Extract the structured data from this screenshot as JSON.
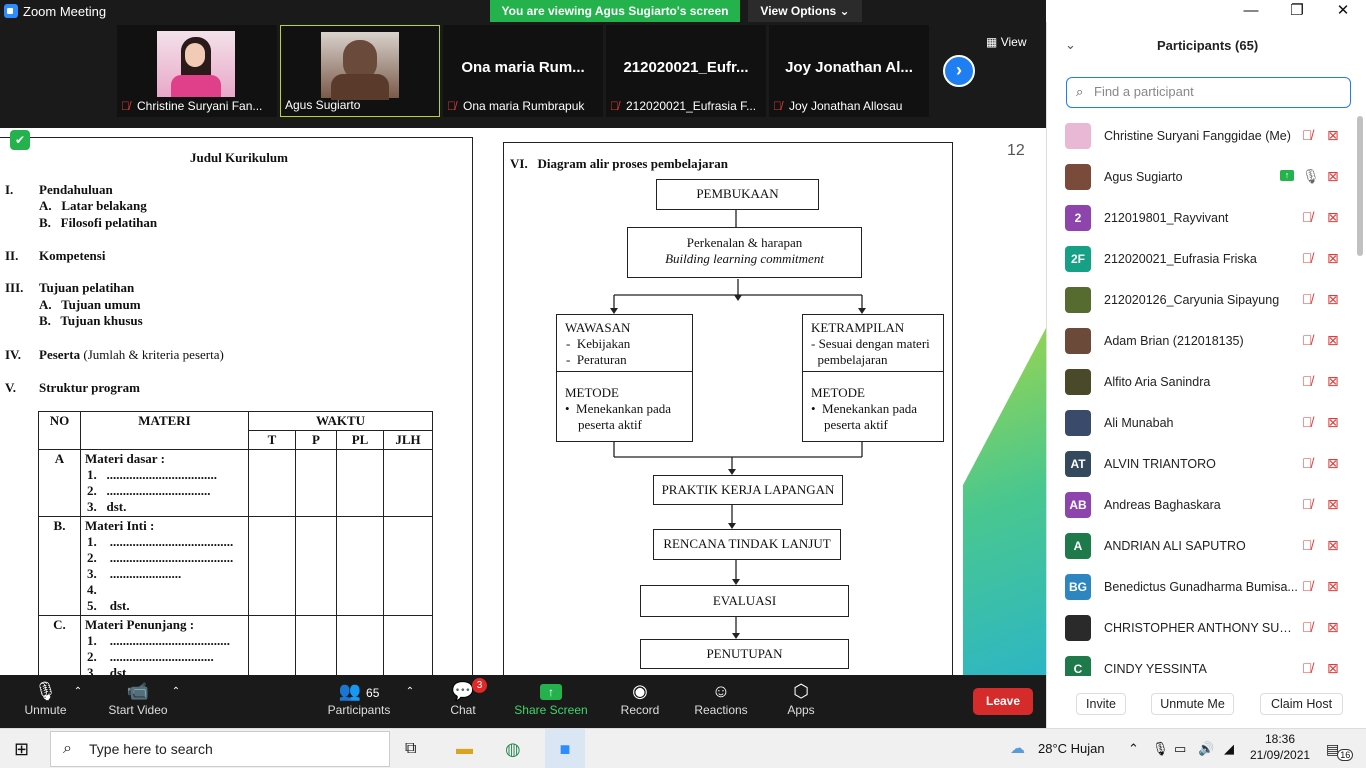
{
  "window": {
    "title": "Zoom Meeting",
    "share_banner": "You are viewing Agus Sugiarto's screen",
    "view_options": "View Options ⌄"
  },
  "strip": {
    "view_label": "View",
    "tiles": [
      {
        "bigname": "",
        "label": "Christine Suryani Fan..."
      },
      {
        "bigname": "",
        "label": "Agus Sugiarto"
      },
      {
        "bigname": "Ona maria Rum...",
        "label": "Ona maria Rumbrapuk"
      },
      {
        "bigname": "212020021_Eufr...",
        "label": "212020021_Eufrasia F..."
      },
      {
        "bigname": "Joy Jonathan Al...",
        "label": "Joy Jonathan Allosau"
      }
    ]
  },
  "doc": {
    "left": {
      "title": "Judul Kurikulum",
      "s1": "I.",
      "s1t": "Pendahuluan",
      "s1a": "A.   Latar belakang",
      "s1b": "B.   Filosofi pelatihan",
      "s2": "II.",
      "s2t": "Kompetensi",
      "s3": "III.",
      "s3t": "Tujuan pelatihan",
      "s3a": "A.   Tujuan umum",
      "s3b": "B.   Tujuan khusus",
      "s4": "IV.",
      "s4t": "Peserta",
      "s4n": "(Jumlah & kriteria peserta)",
      "s5": "V.",
      "s5t": "Struktur program",
      "table": {
        "headers": {
          "no": "NO",
          "materi": "MATERI",
          "waktu": "WAKTU",
          "t": "T",
          "p": "P",
          "pl": "PL",
          "jlh": "JLH"
        },
        "rows": [
          {
            "no": "A",
            "title": "Materi dasar :",
            "items": "1.   ..................................\n2.   ................................\n3.   dst."
          },
          {
            "no": "B.",
            "title": "Materi Inti :",
            "items": "1.    ......................................\n2.    ......................................\n3.    ......................\n4.\n5.    dst."
          },
          {
            "no": "C.",
            "title": "Materi Penunjang :",
            "items": "1.    .....................................\n2.    ................................\n3.    dst."
          }
        ]
      }
    },
    "right": {
      "heading": "VI.   Diagram alir proses pembelajaran",
      "pembukaan": "PEMBUKAAN",
      "perkenalan": "Perkenalan & harapan",
      "building": "Building learning commitment",
      "wawasan": "WAWASAN",
      "wawasan_items": "-  Kebijakan\n-  Peraturan",
      "metode": "METODE",
      "metode_items": "•  Menekankan pada\n    peserta aktif",
      "ketrampilan": "KETRAMPILAN",
      "ketrampilan_items": "- Sesuai dengan materi\n  pembelajaran",
      "metode2": "METODE",
      "metode2_items": "•  Menekankan pada\n    peserta aktif",
      "praktik": "PRAKTIK KERJA LAPANGAN",
      "rencana": "RENCANA TINDAK LANJUT",
      "evaluasi": "EVALUASI",
      "penutupan": "PENUTUPAN"
    },
    "page_number": "12"
  },
  "toolbar": {
    "unmute": "Unmute",
    "start_video": "Start Video",
    "participants": "Participants",
    "participants_count": "65",
    "chat": "Chat",
    "chat_badge": "3",
    "share_screen": "Share Screen",
    "record": "Record",
    "reactions": "Reactions",
    "apps": "Apps",
    "leave": "Leave"
  },
  "panel": {
    "title": "Participants (65)",
    "search_placeholder": "Find a participant",
    "participants": [
      {
        "initials": "",
        "name": "Christine Suryani Fanggidae (Me)",
        "color": "#e9b8d4"
      },
      {
        "initials": "",
        "name": "Agus Sugiarto",
        "color": "#7a4a3a"
      },
      {
        "initials": "2",
        "name": "212019801_Rayvivant",
        "color": "#8e44ad"
      },
      {
        "initials": "2F",
        "name": "212020021_Eufrasia Friska",
        "color": "#16a085"
      },
      {
        "initials": "",
        "name": "212020126_Caryunia Sipayung",
        "color": "#556b2f"
      },
      {
        "initials": "",
        "name": "Adam Brian (212018135)",
        "color": "#6b4a3a"
      },
      {
        "initials": "",
        "name": "Alfito Aria Sanindra",
        "color": "#4a4a2a"
      },
      {
        "initials": "",
        "name": "Ali Munabah",
        "color": "#3a4a6a"
      },
      {
        "initials": "AT",
        "name": "ALVIN TRIANTORO",
        "color": "#34495e"
      },
      {
        "initials": "AB",
        "name": "Andreas Baghaskara",
        "color": "#8e44ad"
      },
      {
        "initials": "A",
        "name": "ANDRIAN ALI SAPUTRO",
        "color": "#1e7a4a"
      },
      {
        "initials": "BG",
        "name": "Benedictus Gunadharma Bumisa...",
        "color": "#2e86c1"
      },
      {
        "initials": "",
        "name": "CHRISTOPHER ANTHONY SURY...",
        "color": "#2a2a2a"
      },
      {
        "initials": "C",
        "name": "CINDY YESSINTA",
        "color": "#1e7a4a"
      }
    ],
    "invite": "Invite",
    "unmute_me": "Unmute Me",
    "claim_host": "Claim Host"
  },
  "taskbar": {
    "search_placeholder": "Type here to search",
    "weather": "28°C  Hujan",
    "time": "18:36",
    "date": "21/09/2021",
    "notif": "16"
  }
}
